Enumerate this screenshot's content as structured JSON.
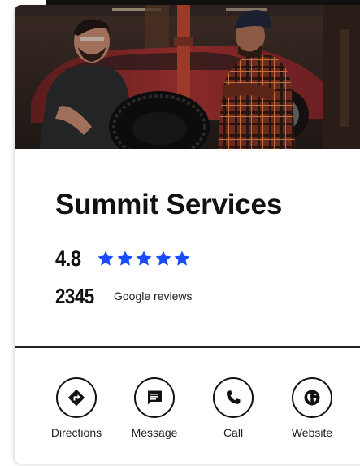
{
  "hero": {
    "image_description_name": "mechanics-tire-photo"
  },
  "business": {
    "name": "Summit Services",
    "rating": "4.8",
    "star_count": 5,
    "star_color": "#1a4cff",
    "reviews_count": "2345",
    "reviews_label": "Google reviews"
  },
  "actions": [
    {
      "label": "Directions",
      "icon": "directions-icon"
    },
    {
      "label": "Message",
      "icon": "message-icon"
    },
    {
      "label": "Call",
      "icon": "phone-icon"
    },
    {
      "label": "Website",
      "icon": "globe-icon"
    }
  ]
}
